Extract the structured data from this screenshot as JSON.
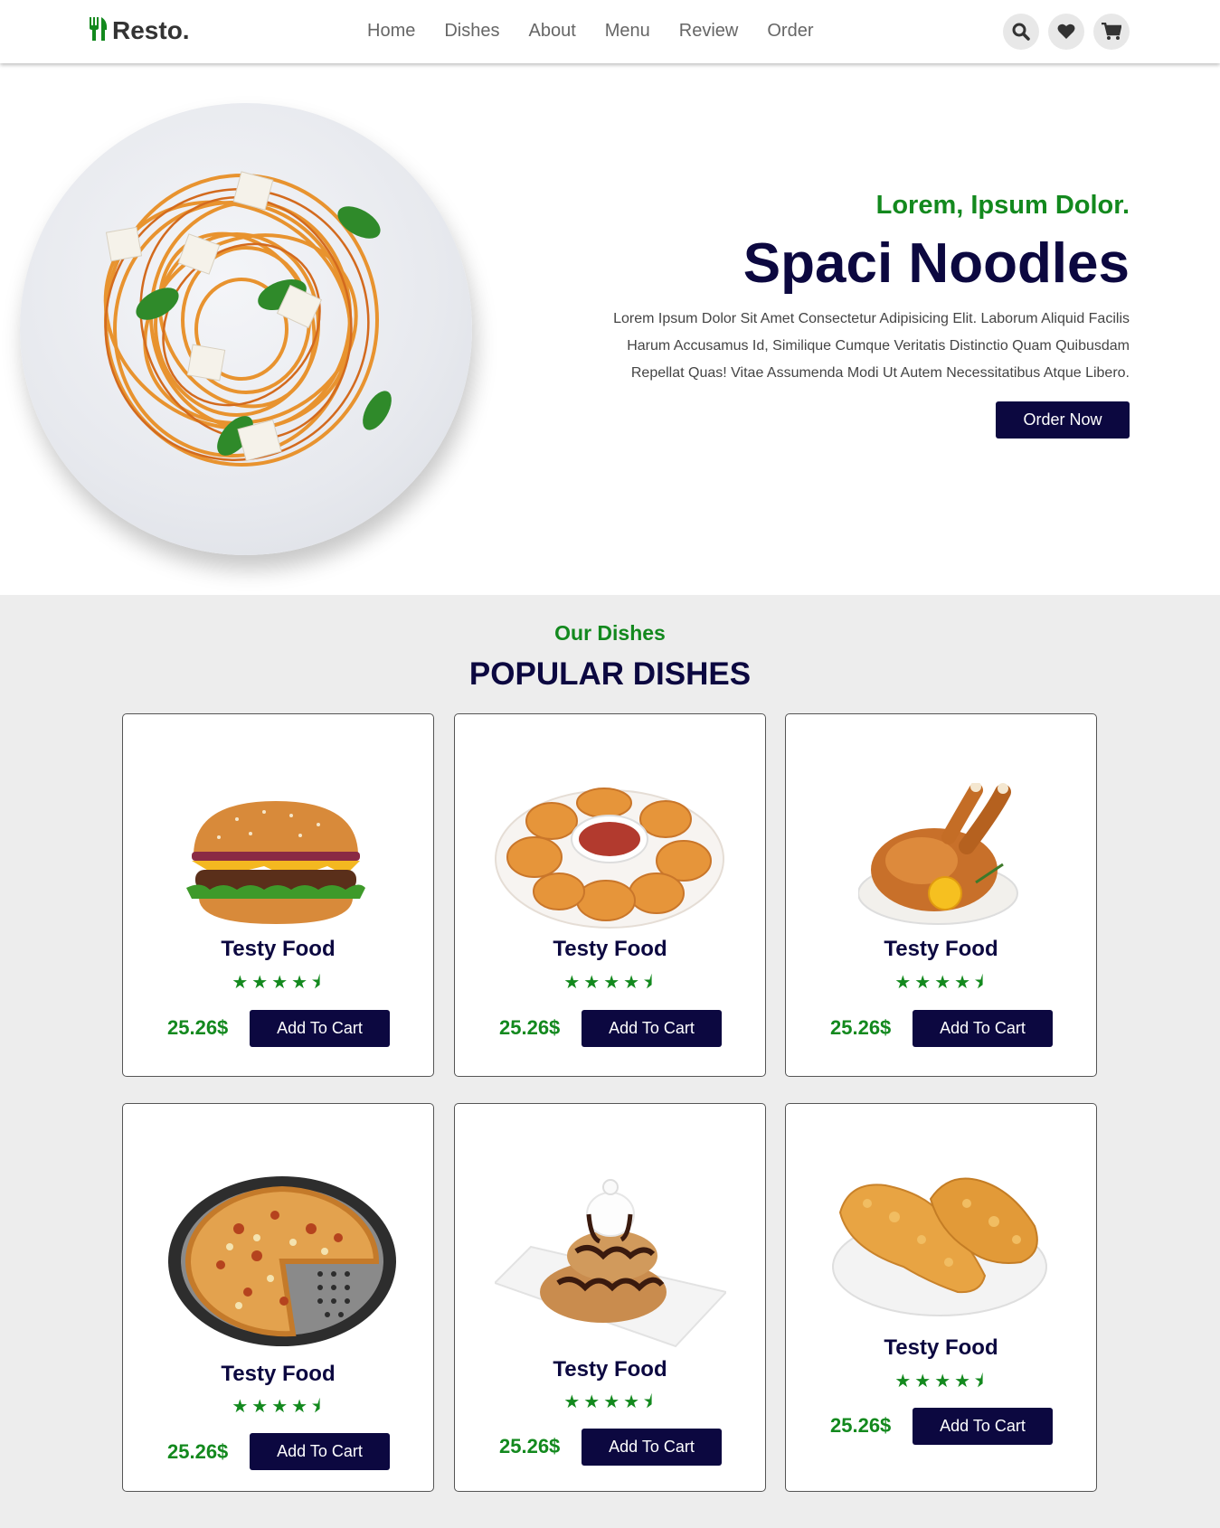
{
  "header": {
    "logo": "Resto.",
    "nav": [
      "Home",
      "Dishes",
      "About",
      "Menu",
      "Review",
      "Order"
    ],
    "icons": [
      "search-icon",
      "heart-icon",
      "cart-icon"
    ]
  },
  "hero": {
    "subtitle": "Lorem, Ipsum Dolor.",
    "title": "Spaci Noodles",
    "text": "Lorem Ipsum Dolor Sit Amet Consectetur Adipisicing Elit. Laborum Aliquid Facilis Harum Accusamus Id, Similique Cumque Veritatis Distinctio Quam Quibusdam Repellat Quas! Vitae Assumenda Modi Ut Autem Necessitatibus Atque Libero.",
    "button": "Order Now"
  },
  "dishes": {
    "subtitle": "Our Dishes",
    "title": "POPULAR DISHES",
    "items": [
      {
        "name": "Testy Food",
        "rating": 4.5,
        "price": "25.26$",
        "button": "Add To Cart",
        "image": "burger"
      },
      {
        "name": "Testy Food",
        "rating": 4.5,
        "price": "25.26$",
        "button": "Add To Cart",
        "image": "nuggets"
      },
      {
        "name": "Testy Food",
        "rating": 4.5,
        "price": "25.26$",
        "button": "Add To Cart",
        "image": "roast-chicken"
      },
      {
        "name": "Testy Food",
        "rating": 4.5,
        "price": "25.26$",
        "button": "Add To Cart",
        "image": "pizza"
      },
      {
        "name": "Testy Food",
        "rating": 4.5,
        "price": "25.26$",
        "button": "Add To Cart",
        "image": "dessert"
      },
      {
        "name": "Testy Food",
        "rating": 4.5,
        "price": "25.26$",
        "button": "Add To Cart",
        "image": "fried-chicken"
      }
    ]
  },
  "colors": {
    "accent_green": "#13891e",
    "navy": "#0c0840",
    "section_bg": "#ededed"
  }
}
